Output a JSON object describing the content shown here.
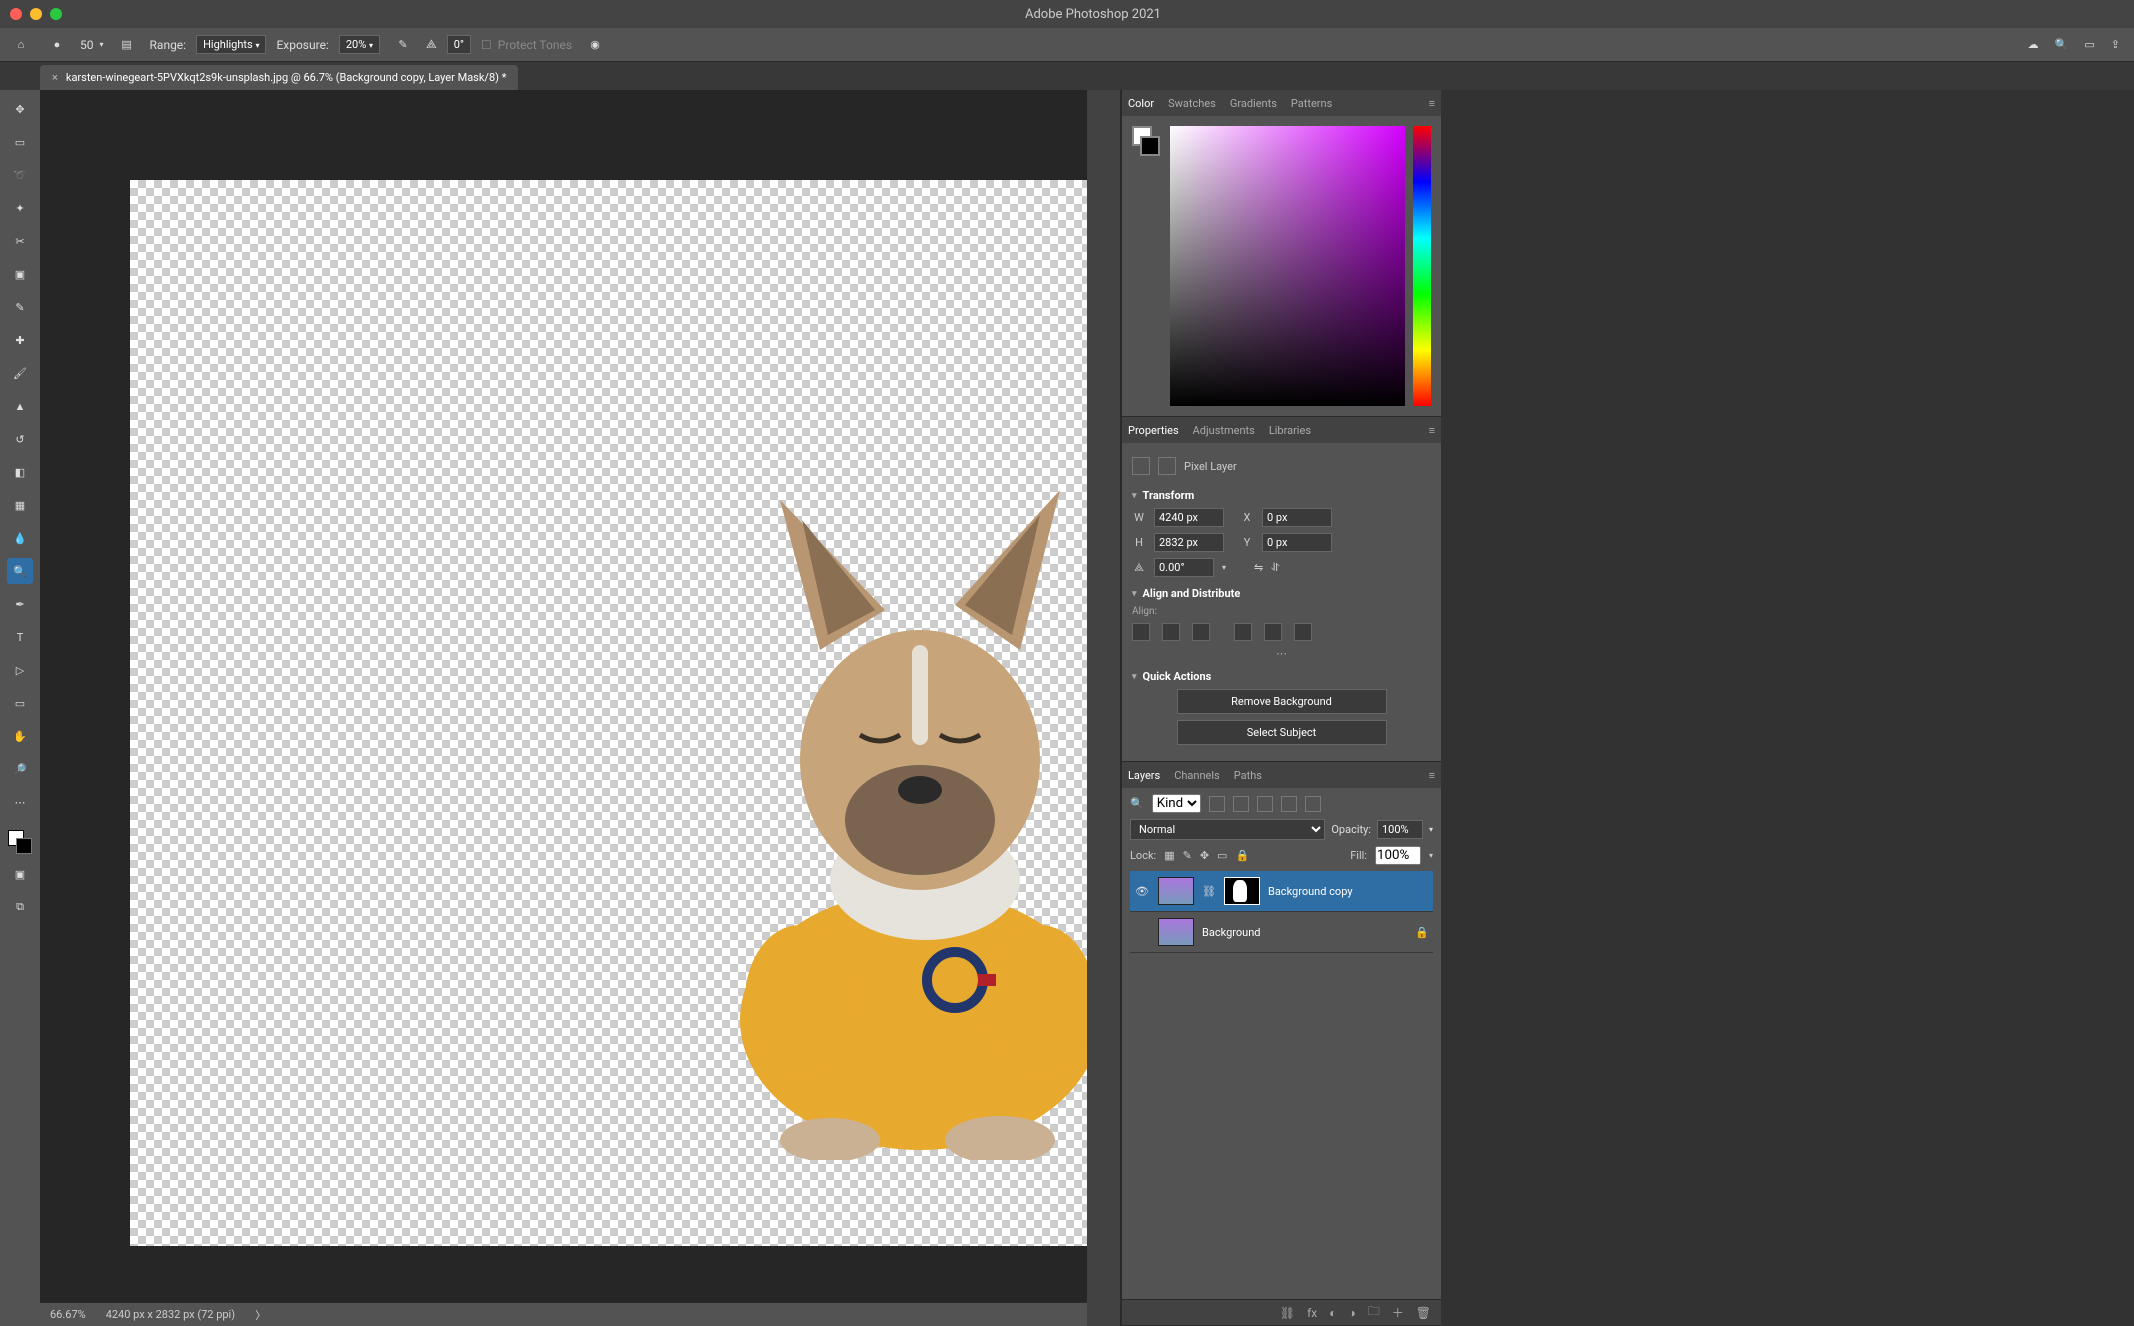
{
  "app": {
    "title": "Adobe Photoshop 2021"
  },
  "options_bar": {
    "brush_size": "50",
    "range_label": "Range:",
    "range_value": "Highlights",
    "exposure_label": "Exposure:",
    "exposure_value": "20%",
    "angle_value": "0°",
    "protect_tones": "Protect Tones"
  },
  "document": {
    "tab_title": "karsten-winegeart-5PVXkqt2s9k-unsplash.jpg @ 66.7% (Background copy, Layer Mask/8) *"
  },
  "panels": {
    "color_tabs": [
      "Color",
      "Swatches",
      "Gradients",
      "Patterns"
    ],
    "props_tabs": [
      "Properties",
      "Adjustments",
      "Libraries"
    ],
    "layers_tabs": [
      "Layers",
      "Channels",
      "Paths"
    ]
  },
  "properties": {
    "type_label": "Pixel Layer",
    "transform": {
      "header": "Transform",
      "w_label": "W",
      "w_value": "4240 px",
      "h_label": "H",
      "h_value": "2832 px",
      "x_label": "X",
      "x_value": "0 px",
      "y_label": "Y",
      "y_value": "0 px",
      "angle": "0.00°"
    },
    "align_header": "Align and Distribute",
    "align_sub": "Align:",
    "quick_header": "Quick Actions",
    "remove_bg": "Remove Background",
    "select_subject": "Select Subject"
  },
  "layers": {
    "filter_label": "Kind",
    "blend_mode": "Normal",
    "opacity_label": "Opacity:",
    "opacity_value": "100%",
    "lock_label": "Lock:",
    "fill_label": "Fill:",
    "fill_value": "100%",
    "items": [
      {
        "name": "Background copy",
        "visible": true,
        "mask": true,
        "locked": false
      },
      {
        "name": "Background",
        "visible": false,
        "mask": false,
        "locked": true
      }
    ]
  },
  "status": {
    "zoom": "66.67%",
    "doc_info": "4240 px x 2832 px (72 ppi)"
  }
}
